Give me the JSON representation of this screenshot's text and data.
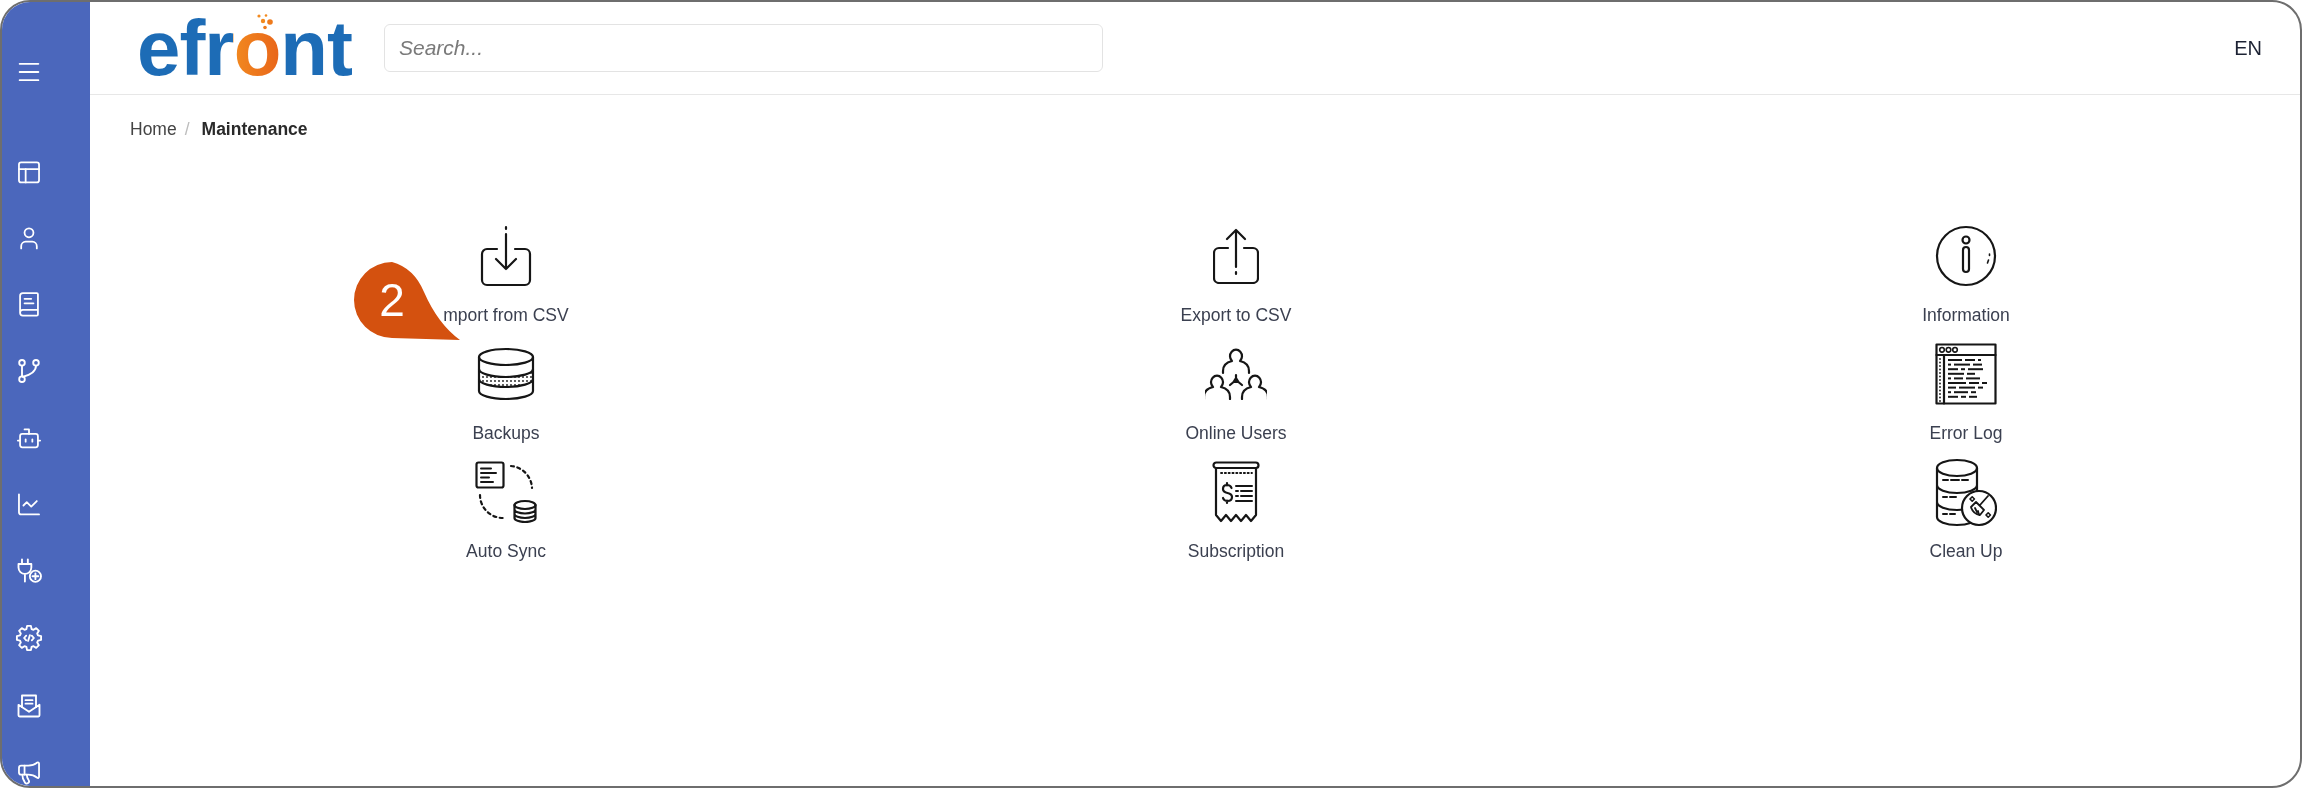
{
  "logo": {
    "text": "efront"
  },
  "search": {
    "placeholder": "Search..."
  },
  "language": {
    "label": "EN"
  },
  "breadcrumb": {
    "separator": "/",
    "items": [
      {
        "label": "Home",
        "current": false
      },
      {
        "label": "Maintenance",
        "current": true
      }
    ]
  },
  "tools": [
    {
      "kind": "import",
      "label": "mport from CSV"
    },
    {
      "kind": "export",
      "label": "Export to CSV"
    },
    {
      "kind": "information",
      "label": "Information"
    },
    {
      "kind": "backups",
      "label": "Backups"
    },
    {
      "kind": "users",
      "label": "Online Users"
    },
    {
      "kind": "log",
      "label": "Error Log"
    },
    {
      "kind": "sync",
      "label": "Auto Sync"
    },
    {
      "kind": "subscription",
      "label": "Subscription"
    },
    {
      "kind": "cleanup",
      "label": "Clean Up"
    }
  ],
  "step_badge": {
    "text": "2"
  }
}
